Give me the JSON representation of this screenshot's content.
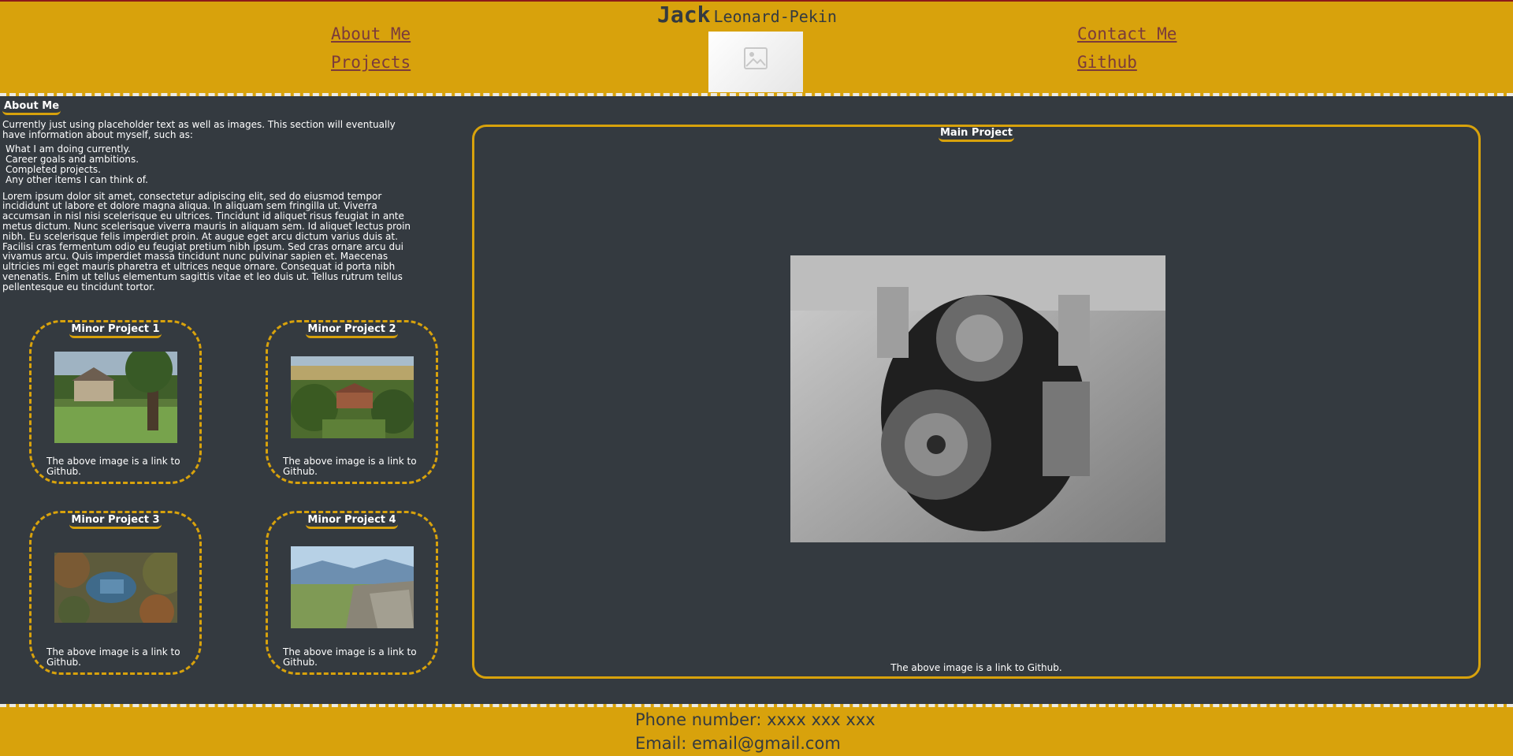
{
  "header": {
    "first_name": "Jack",
    "last_name": "Leonard-Pekin",
    "nav": {
      "about": "About Me",
      "projects": "Projects",
      "contact": "Contact Me",
      "github": "Github"
    }
  },
  "about": {
    "heading": "About Me",
    "intro": "Currently just using placeholder text as well as images. This section will eventually have information about myself, such as:",
    "items": [
      "What I am doing currently.",
      "Career goals and ambitions.",
      "Completed projects.",
      "Any other items I can think of."
    ],
    "body": "Lorem ipsum dolor sit amet, consectetur adipiscing elit, sed do eiusmod tempor incididunt ut labore et dolore magna aliqua. In aliquam sem fringilla ut. Viverra accumsan in nisl nisi scelerisque eu ultrices. Tincidunt id aliquet risus feugiat in ante metus dictum. Nunc scelerisque viverra mauris in aliquam sem. Id aliquet lectus proin nibh. Eu scelerisque felis imperdiet proin. At augue eget arcu dictum varius duis at. Facilisi cras fermentum odio eu feugiat pretium nibh ipsum. Sed cras ornare arcu dui vivamus arcu. Quis imperdiet massa tincidunt nunc pulvinar sapien et. Maecenas ultricies mi eget mauris pharetra et ultrices neque ornare. Consequat id porta nibh venenatis. Enim ut tellus elementum sagittis vitae et leo duis ut. Tellus rutrum tellus pellentesque eu tincidunt tortor."
  },
  "minor_projects": [
    {
      "title": "Minor Project 1",
      "caption": "The above image is a link to Github."
    },
    {
      "title": "Minor Project 2",
      "caption": "The above image is a link to Github."
    },
    {
      "title": "Minor Project 3",
      "caption": "The above image is a link to Github."
    },
    {
      "title": "Minor Project 4",
      "caption": "The above image is a link to Github."
    }
  ],
  "main_project": {
    "title": "Main Project",
    "caption": "The above image is a link to Github."
  },
  "footer": {
    "phone": "Phone number: xxxx xxx xxx",
    "email": "Email: email@gmail.com"
  },
  "colors": {
    "accent": "#d8a20c",
    "background": "#343a40",
    "nav_link": "#7b3b3b"
  }
}
